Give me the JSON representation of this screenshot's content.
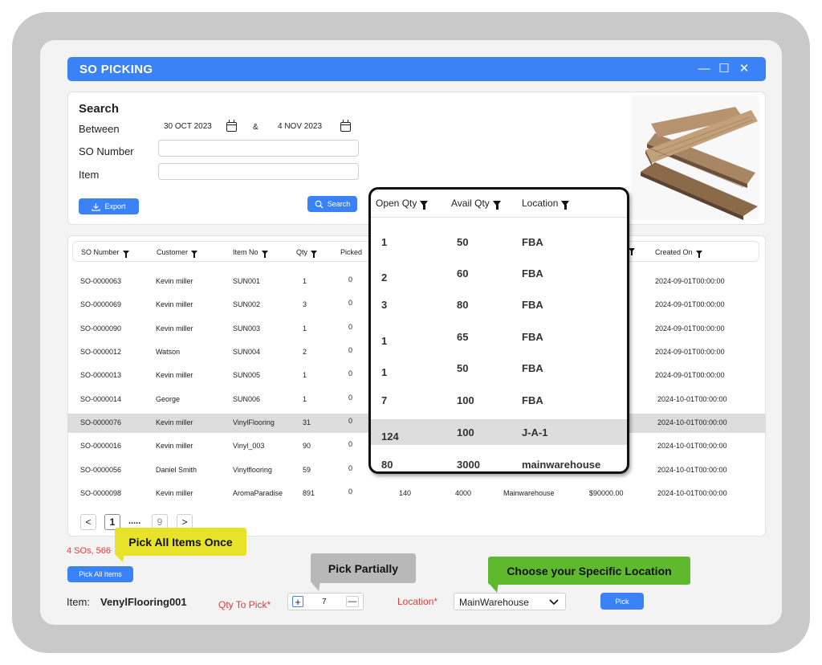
{
  "window": {
    "title": "SO PICKING",
    "controls": [
      "—",
      "☐",
      "✕"
    ]
  },
  "search": {
    "heading": "Search",
    "between_label": "Between",
    "date_from": "30 OCT 2023",
    "date_sep": "&",
    "date_to": "4 NOV 2023",
    "so_number_label": "SO Number",
    "item_label": "Item",
    "export_label": "Export",
    "search_label": "Search"
  },
  "table": {
    "columns": [
      "SO Number",
      "Customer",
      "Item No",
      "Qty",
      "Picked",
      "Created On"
    ],
    "rows": [
      {
        "so": "SO-0000063",
        "customer": "Kevin miller",
        "item": "SUN001",
        "qty": "1",
        "picked": "0",
        "created": "2024-09-01T00:00:00"
      },
      {
        "so": "SO-0000069",
        "customer": "Kevin miller",
        "item": "SUN002",
        "qty": "3",
        "picked": "0",
        "created": "2024-09-01T00:00:00"
      },
      {
        "so": "SO-0000090",
        "customer": "Kevin miller",
        "item": "SUN003",
        "qty": "1",
        "picked": "0",
        "created": "2024-09-01T00:00:00"
      },
      {
        "so": "SO-0000012",
        "customer": "Watson",
        "item": "SUN004",
        "qty": "2",
        "picked": "0",
        "created": "2024-09-01T00:00:00"
      },
      {
        "so": "SO-0000013",
        "customer": "Kevin miller",
        "item": "SUN005",
        "qty": "1",
        "picked": "0",
        "created": "2024-09-01T00:00:00"
      },
      {
        "so": "SO-0000014",
        "customer": "George",
        "item": "SUN006",
        "qty": "1",
        "picked": "0",
        "created": "2024-10-01T00:00:00"
      },
      {
        "so": "SO-0000076",
        "customer": "Kevin miller",
        "item": "VinylFlooring",
        "qty": "31",
        "picked": "0",
        "created": "2024-10-01T00:00:00"
      },
      {
        "so": "SO-0000016",
        "customer": "Kevin miller",
        "item": "Vinyl_003",
        "qty": "90",
        "picked": "0",
        "created": "2024-10-01T00:00:00"
      },
      {
        "so": "SO-0000056",
        "customer": "Daniel Smith",
        "item": "Vinylflooring",
        "qty": "59",
        "picked": "0",
        "created": "2024-10-01T00:00:00"
      },
      {
        "so": "SO-0000098",
        "customer": "Kevin miller",
        "item": "AromaParadise",
        "qty": "891",
        "picked": "0",
        "created": "2024-10-01T00:00:00",
        "open": "140",
        "avail": "4000",
        "location": "Mainwarehouse",
        "amount": "$90000.00"
      }
    ]
  },
  "pager": {
    "prev": "<",
    "current": "1",
    "dots": ".....",
    "last": "9",
    "next": ">"
  },
  "summary_text": "4 SOs, 566",
  "pick_all_label": "Pick All Items",
  "item_label": "Item:",
  "item_value": "VenylFlooring001",
  "qty_label": "Qty To Pick*",
  "qty_value": "7",
  "location_label": "Location*",
  "location_value": "MainWarehouse",
  "pick_label": "Pick",
  "callouts": {
    "pick_all": "Pick All Items Once",
    "partial": "Pick Partially",
    "location": "Choose your Specific Location"
  },
  "popup": {
    "columns": [
      "Open Qty",
      "Avail Qty",
      "Location"
    ],
    "rows": [
      {
        "open": "1",
        "avail": "50",
        "location": "FBA"
      },
      {
        "open": "2",
        "avail": "60",
        "location": "FBA"
      },
      {
        "open": "3",
        "avail": "80",
        "location": "FBA"
      },
      {
        "open": "1",
        "avail": "65",
        "location": "FBA"
      },
      {
        "open": "1",
        "avail": "50",
        "location": "FBA"
      },
      {
        "open": "7",
        "avail": "100",
        "location": "FBA"
      },
      {
        "open": "124",
        "avail": "100",
        "location": "J-A-1"
      },
      {
        "open": "80",
        "avail": "3000",
        "location": "mainwarehouse"
      }
    ]
  },
  "colors": {
    "accent": "#3b82f6",
    "callout_yellow": "#e8e32a",
    "callout_gray": "#b8b8b8",
    "callout_green": "#5fb92f",
    "required_red": "#e53935"
  }
}
